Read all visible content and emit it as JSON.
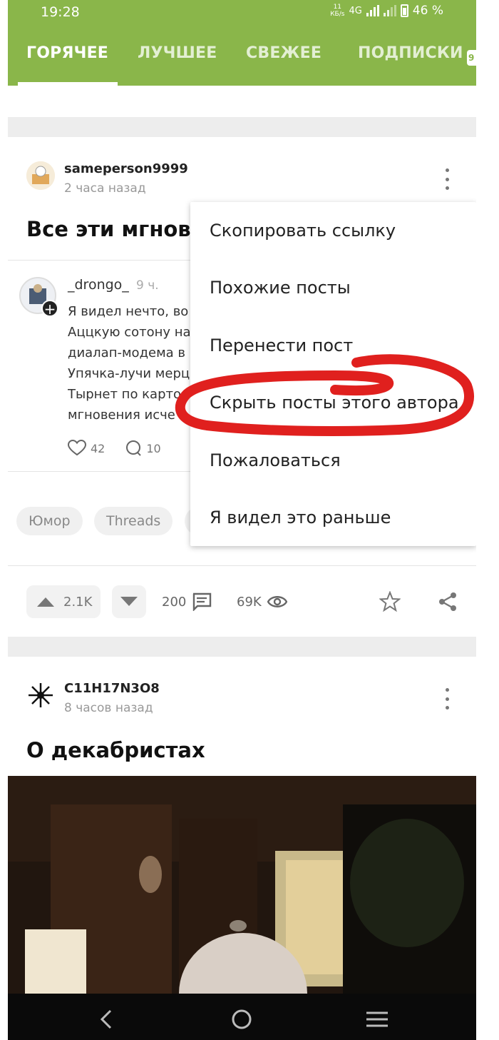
{
  "status_bar": {
    "time": "19:28",
    "speed_value": "11",
    "speed_unit": "КБ/s",
    "network": "4G",
    "battery": "46 %"
  },
  "tabs": [
    {
      "label": "ГОРЯЧЕЕ",
      "active": true
    },
    {
      "label": "ЛУЧШЕЕ",
      "active": false
    },
    {
      "label": "СВЕЖЕЕ",
      "active": false
    },
    {
      "label": "ПОДПИСКИ",
      "active": false
    }
  ],
  "tabs_badge": "9",
  "post": {
    "author": "sameperson9999",
    "time": "2 часа назад",
    "title": "Все эти мгнове",
    "comment": {
      "author": "_drongo_",
      "time": "9 ч.",
      "lines": [
        "Я видел нечто, во",
        "Аццкую сотону на",
        "диалап-модема в",
        "Упячка-лучи мерц",
        "Тырнет по карто",
        "мгновения исче"
      ],
      "likes": "42",
      "replies": "10"
    },
    "tags": [
      "Юмор",
      "Threads"
    ],
    "rating": "2.1K",
    "comments_count": "200",
    "views": "69K"
  },
  "menu": {
    "items": [
      "Скопировать ссылку",
      "Похожие посты",
      "Перенести пост",
      "Скрыть посты этого автора",
      "Пожаловаться",
      "Я видел это раньше"
    ]
  },
  "next_post": {
    "author": "C11H17N3O8",
    "time": "8 часов назад",
    "title": "О декабристах"
  },
  "colors": {
    "header": "#8ab64a",
    "scribble": "#e0201e"
  }
}
